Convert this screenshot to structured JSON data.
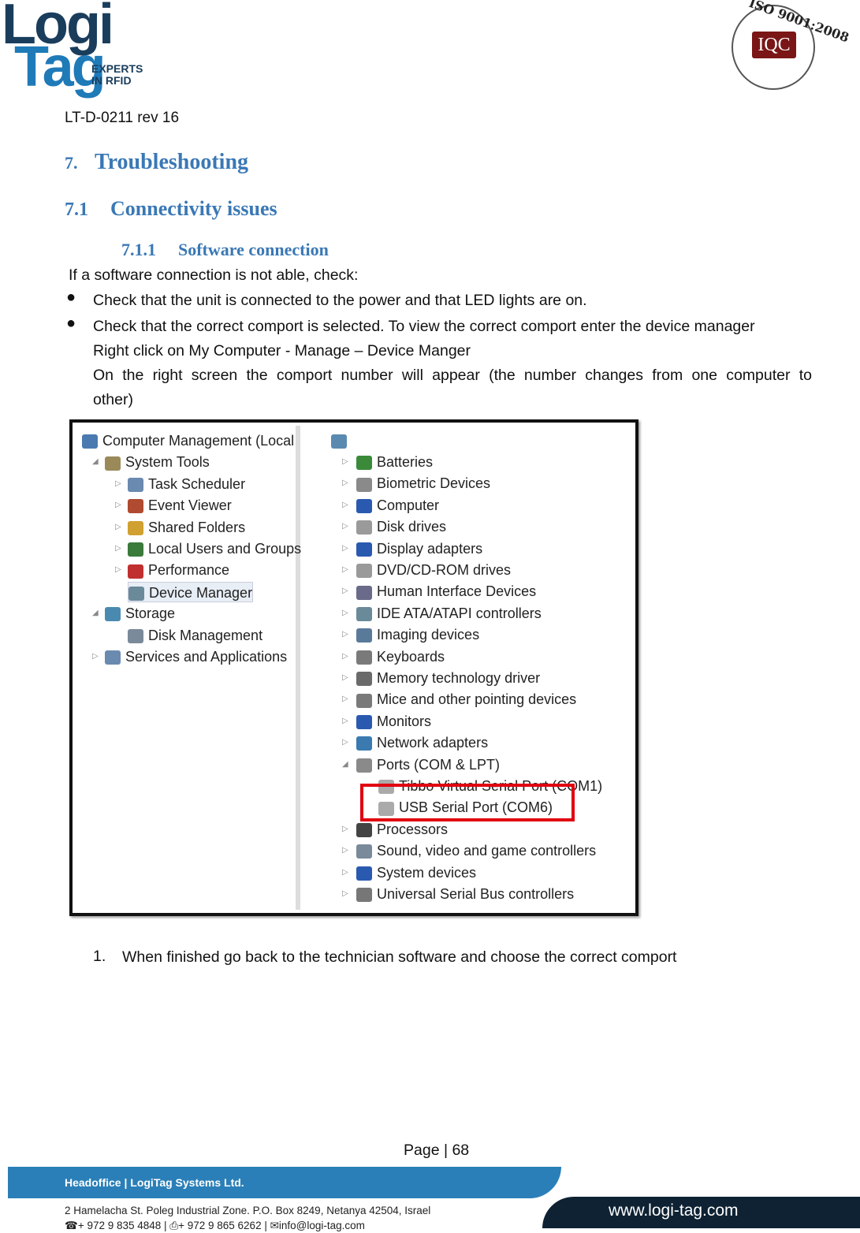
{
  "header": {
    "logo_top": "Logi",
    "logo_bottom": "Tag",
    "logo_sub": [
      "EXPERTS",
      "IN RFID"
    ],
    "cert_ring": "ISO 9001:2008",
    "cert_mark": "IQC",
    "doc_id": "LT-D-0211 rev 16"
  },
  "sections": {
    "h1_num": "7.",
    "h1": "Troubleshooting",
    "h2_num": "7.1",
    "h2": "Connectivity issues",
    "h3_num": "7.1.1",
    "h3": "Software connection"
  },
  "body": {
    "intro": "If a software connection is not able, check:",
    "bullet1": "Check that the unit is connected to the power and that LED lights are on.",
    "bullet2": "Check that the correct comport is selected. To view the correct comport enter the device manager",
    "line2": "Right click on My Computer - Manage – Device Manger",
    "line3": "On the right screen the comport number will appear (the number changes from one computer to other)",
    "step_num": "1.",
    "step": "When finished go back to the technician software and choose the correct comport"
  },
  "screenshot": {
    "left_tree": [
      "Computer Management (Local",
      "System Tools",
      "Task Scheduler",
      "Event Viewer",
      "Shared Folders",
      "Local Users and Groups",
      "Performance",
      "Device Manager",
      "Storage",
      "Disk Management",
      "Services and Applications"
    ],
    "right_tree": [
      "Batteries",
      "Biometric Devices",
      "Computer",
      "Disk drives",
      "Display adapters",
      "DVD/CD-ROM drives",
      "Human Interface Devices",
      "IDE ATA/ATAPI controllers",
      "Imaging devices",
      "Keyboards",
      "Memory technology driver",
      "Mice and other pointing devices",
      "Monitors",
      "Network adapters",
      "Ports (COM & LPT)",
      "Tibbo Virtual Serial Port (COM1)",
      "USB Serial Port (COM6)",
      "Processors",
      "Sound, video and game controllers",
      "System devices",
      "Universal Serial Bus controllers"
    ],
    "highlight_color": "#e00010"
  },
  "page": {
    "label": "Page | 68"
  },
  "footer": {
    "headoffice": "Headoffice  |  LogiTag Systems Ltd.",
    "address": "2 Hamelacha St. Poleg Industrial Zone.  P.O. Box 8249, Netanya 42504, Israel",
    "contacts": "☎+ 972 9 835 4848  |  ⎙+ 972 9 865 6262  |  ✉info@logi-tag.com",
    "website": "www.logi-tag.com"
  },
  "colors": {
    "heading": "#3a78b5",
    "footer_blue": "#2a7fb8",
    "footer_dark": "#0e2233"
  }
}
